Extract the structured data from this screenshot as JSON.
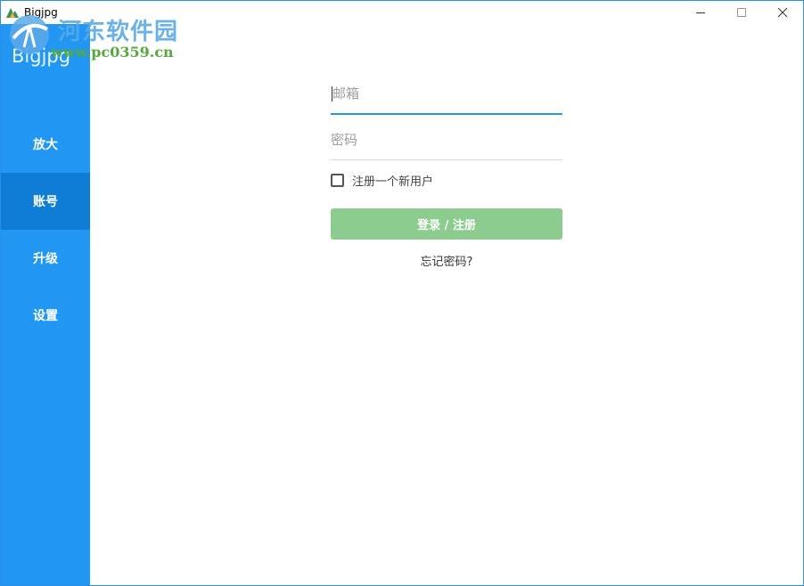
{
  "window": {
    "title": "Bigjpg",
    "controls": {
      "minimize_icon": "minimize-icon",
      "maximize_icon": "maximize-icon",
      "close_icon": "close-icon"
    }
  },
  "watermark": {
    "site_name": "河东软件园",
    "url": "www.pc0359.cn"
  },
  "sidebar": {
    "brand": "Bigjpg",
    "items": [
      {
        "label": "放大",
        "active": false
      },
      {
        "label": "账号",
        "active": true
      },
      {
        "label": "升级",
        "active": false
      },
      {
        "label": "设置",
        "active": false
      }
    ]
  },
  "login": {
    "email_placeholder": "邮箱",
    "email_value": "",
    "password_placeholder": "密码",
    "password_value": "",
    "register_checkbox_label": "注册一个新用户",
    "register_checked": false,
    "submit_label": "登录 / 注册",
    "forgot_label": "忘记密码?"
  },
  "colors": {
    "sidebar": "#2196f3",
    "sidebar_active": "#0f7cd6",
    "accent": "#2196f3",
    "submit_button": "#8ccc8e",
    "window_border": "#2b8fe6"
  }
}
